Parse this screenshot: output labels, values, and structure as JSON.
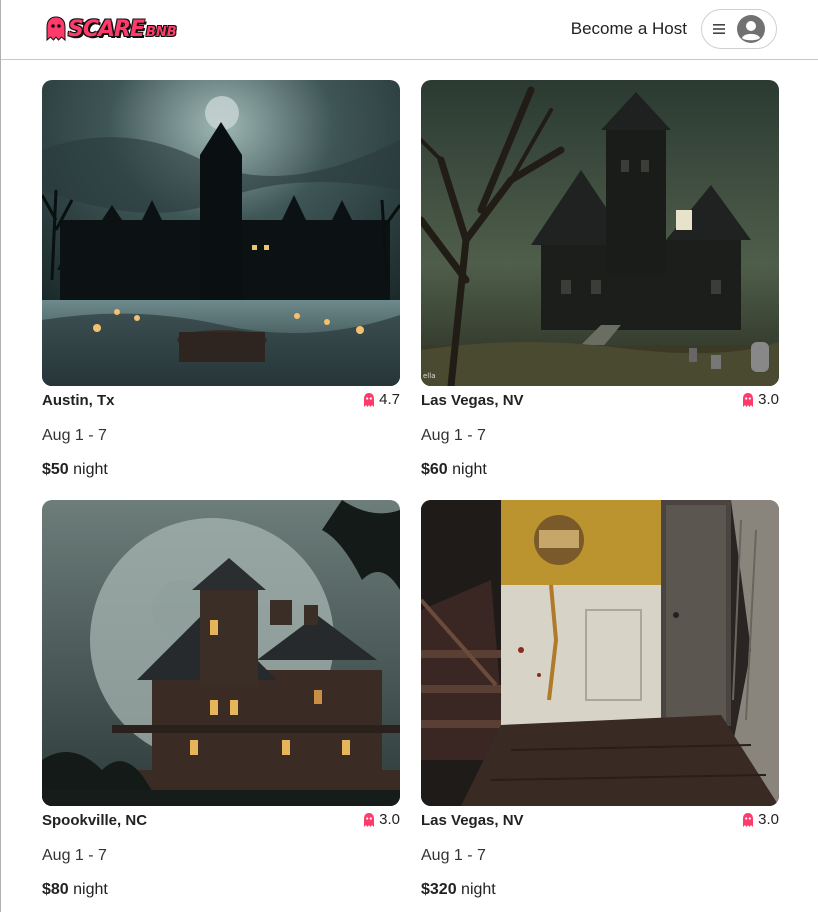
{
  "header": {
    "logo_main": "SCARE",
    "logo_suffix": "BNB",
    "become_host": "Become a Host"
  },
  "colors": {
    "accent": "#ff3b6b"
  },
  "icons": {
    "logo": "ghost-icon",
    "menu": "hamburger-menu-icon",
    "avatar": "user-avatar-icon",
    "rating": "ghost-icon"
  },
  "listings": [
    {
      "location": "Austin, Tx",
      "rating": "4.7",
      "dates": "Aug 1 - 7",
      "price": "$50",
      "price_unit": "night"
    },
    {
      "location": "Las Vegas, NV",
      "rating": "3.0",
      "dates": "Aug 1 - 7",
      "price": "$60",
      "price_unit": "night"
    },
    {
      "location": "Spookville, NC",
      "rating": "3.0",
      "dates": "Aug 1 - 7",
      "price": "$80",
      "price_unit": "night"
    },
    {
      "location": "Las Vegas, NV",
      "rating": "3.0",
      "dates": "Aug 1 - 7",
      "price": "$320",
      "price_unit": "night"
    }
  ]
}
